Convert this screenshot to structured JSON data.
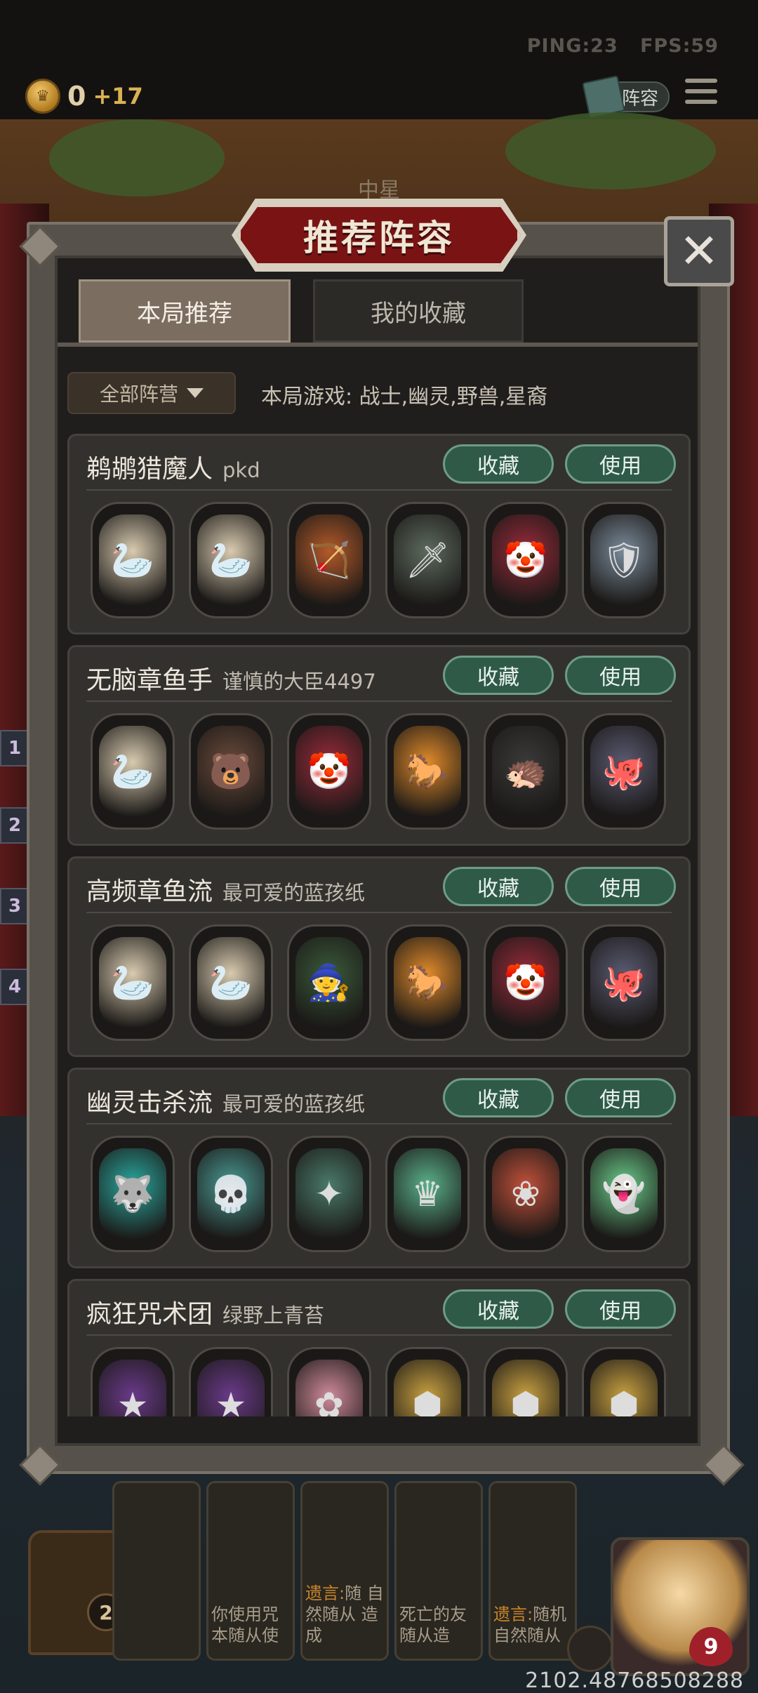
{
  "hud": {
    "ping": "PING:23",
    "fps": "FPS:59",
    "gold": "0",
    "gold_income": "+17",
    "lineup_button": "阵容"
  },
  "scene": {
    "tier_label": "中星",
    "side_numbers": [
      "1",
      "2",
      "3",
      "4"
    ],
    "bottom_cards": [
      {
        "text": ""
      },
      {
        "text": "你使用咒 本随从使"
      },
      {
        "highlight": "遗言:",
        "text": "随 自然随从 造成"
      },
      {
        "text": "死亡的友 随从造"
      },
      {
        "highlight": "遗言:",
        "text": "随机 自然随从"
      }
    ],
    "chest_count": "2",
    "hero_health": "9",
    "coordinate": "2102.48768508288"
  },
  "modal": {
    "title": "推荐阵容",
    "close": "✕",
    "tabs": [
      {
        "label": "本局推荐",
        "active": true
      },
      {
        "label": "我的收藏",
        "active": false
      }
    ],
    "faction_filter": "全部阵营",
    "game_info": "本局游戏: 战士,幽灵,野兽,星裔",
    "favorite_label": "收藏",
    "use_label": "使用",
    "lineups": [
      {
        "name": "鹈鹕猎魔人",
        "author": "pkd",
        "heroes": [
          {
            "icon": "pelican-icon",
            "color": "#d9cbb0"
          },
          {
            "icon": "pelican-icon",
            "color": "#d9cbb0"
          },
          {
            "icon": "archer-icon",
            "color": "#b45a2a"
          },
          {
            "icon": "hunter-icon",
            "color": "#5d6a5e"
          },
          {
            "icon": "jester-icon",
            "color": "#9a2a3a"
          },
          {
            "icon": "knight-icon",
            "color": "#7a8a9a"
          }
        ]
      },
      {
        "name": "无脑章鱼手",
        "author": "谨慎的大臣4497",
        "heroes": [
          {
            "icon": "pelican-icon",
            "color": "#d9cbb0"
          },
          {
            "icon": "fire-bear-icon",
            "color": "#6a4a3a"
          },
          {
            "icon": "jester-icon",
            "color": "#9a2a3a"
          },
          {
            "icon": "fire-horse-icon",
            "color": "#e08a2a"
          },
          {
            "icon": "porcupine-icon",
            "color": "#3a3a3a"
          },
          {
            "icon": "octopus-icon",
            "color": "#5a5a72"
          }
        ]
      },
      {
        "name": "高频章鱼流",
        "author": "最可爱的蓝孩纸",
        "heroes": [
          {
            "icon": "pelican-icon",
            "color": "#d9cbb0"
          },
          {
            "icon": "pelican-icon",
            "color": "#d9cbb0"
          },
          {
            "icon": "witch-icon",
            "color": "#3a5a3a"
          },
          {
            "icon": "fire-horse-icon",
            "color": "#e08a2a"
          },
          {
            "icon": "jester-icon",
            "color": "#9a2a3a"
          },
          {
            "icon": "octopus-icon",
            "color": "#5a5a72"
          }
        ]
      },
      {
        "name": "幽灵击杀流",
        "author": "最可爱的蓝孩纸",
        "heroes": [
          {
            "icon": "ghost-wolf-icon",
            "color": "#2aa8a0"
          },
          {
            "icon": "ghost-skull-icon",
            "color": "#4a9a94"
          },
          {
            "icon": "ghost-sorceress-icon",
            "color": "#4a7a6a"
          },
          {
            "icon": "ghost-king-icon",
            "color": "#5ab08a"
          },
          {
            "icon": "redhair-lady-icon",
            "color": "#c0503a"
          },
          {
            "icon": "ghost-cat-icon",
            "color": "#6acc8a"
          }
        ]
      },
      {
        "name": "疯狂咒术团",
        "author": "绿野上青苔",
        "heroes": [
          {
            "icon": "wizard-icon",
            "color": "#6a3a8a"
          },
          {
            "icon": "wizard-icon",
            "color": "#6a3a8a"
          },
          {
            "icon": "flower-girl-icon",
            "color": "#d08a9a"
          },
          {
            "icon": "golem-icon",
            "color": "#c8a040"
          },
          {
            "icon": "golem-icon",
            "color": "#c8a040"
          },
          {
            "icon": "golem-icon",
            "color": "#c8a040"
          }
        ]
      }
    ]
  },
  "icon_glyphs": {
    "pelican-icon": "🦢",
    "archer-icon": "🏹",
    "hunter-icon": "🗡",
    "jester-icon": "🤡",
    "knight-icon": "🛡",
    "fire-bear-icon": "🐻",
    "fire-horse-icon": "🐎",
    "porcupine-icon": "🦔",
    "octopus-icon": "🐙",
    "witch-icon": "🧙",
    "ghost-wolf-icon": "🐺",
    "ghost-skull-icon": "💀",
    "ghost-sorceress-icon": "✦",
    "ghost-king-icon": "♛",
    "redhair-lady-icon": "❀",
    "ghost-cat-icon": "👻",
    "wizard-icon": "★",
    "flower-girl-icon": "✿",
    "golem-icon": "⬢"
  }
}
